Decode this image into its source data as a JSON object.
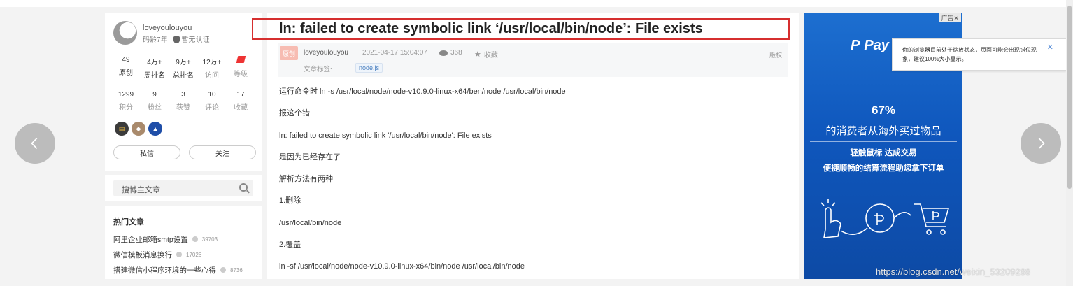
{
  "author": {
    "name": "loveyoulouyou",
    "years": "码龄7年",
    "certification": "暂无认证"
  },
  "stats_row1": [
    {
      "num": "49",
      "label": "原创"
    },
    {
      "num": "4万+",
      "label": "周排名"
    },
    {
      "num": "9万+",
      "label": "总排名"
    },
    {
      "num": "12万+",
      "label": "访问"
    },
    {
      "num": "",
      "label": "等级"
    }
  ],
  "stats_row2": [
    {
      "num": "1299",
      "label": "积分"
    },
    {
      "num": "9",
      "label": "粉丝"
    },
    {
      "num": "3",
      "label": "获赞"
    },
    {
      "num": "10",
      "label": "评论"
    },
    {
      "num": "17",
      "label": "收藏"
    }
  ],
  "buttons": {
    "message": "私信",
    "follow": "关注"
  },
  "search": {
    "placeholder": "搜博主文章"
  },
  "hot_articles": {
    "title": "热门文章",
    "items": [
      {
        "title": "阿里企业邮箱smtp设置",
        "views": "39703"
      },
      {
        "title": "微信模板消息换行",
        "views": "17026"
      },
      {
        "title": "搭建微信小程序环境的一些心得",
        "views": "8736"
      }
    ]
  },
  "article": {
    "title": "ln: failed to create symbolic link ‘/usr/local/bin/node’: File exists",
    "original_tag": "原创",
    "author": "loveyoulouyou",
    "time": "2021-04-17 15:04:07",
    "views": "368",
    "favorite": "收藏",
    "copyright": "版权",
    "tag_label": "文章标签:",
    "tag": "node.js",
    "paragraphs": [
      "运行命令时 ln -s /usr/local/node/node-v10.9.0-linux-x64/ben/node /usr/local/bin/node",
      "报这个错",
      "ln: failed to create symbolic link '/usr/local/bin/node': File exists",
      "是因为已经存在了",
      "解析方法有两种",
      "1.删除",
      "/usr/local/bin/node",
      "2.覆盖",
      "ln -sf /usr/local/node/node-v10.9.0-linux-x64/bin/node /usr/local/bin/node"
    ]
  },
  "ad": {
    "close_label": "广告✕",
    "brand": "Pay",
    "percent": "67%",
    "headline": "的消费者从海外买过物品",
    "sub1": "轻触鼠标 达成交易",
    "sub2": "便捷顺畅的结算流程助您拿下订单"
  },
  "tooltip": {
    "text": "你的浏览器目前处于缩放状态，页面可能会出现错位现象，建议100%大小显示。",
    "close": "✕"
  },
  "watermark": "https://blog.csdn.net/weixin_53209288",
  "colors": {
    "title_border": "#d62f2f",
    "ad_blue": "#0f57bd",
    "tag_blue": "#4a7fbf"
  }
}
